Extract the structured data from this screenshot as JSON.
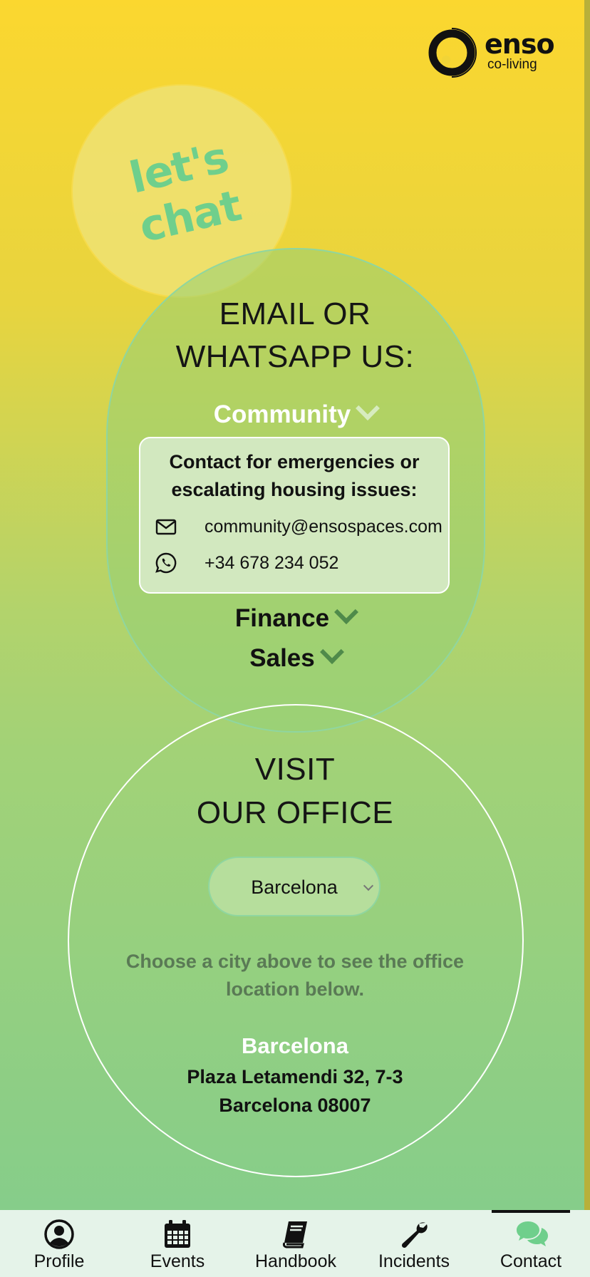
{
  "brand": {
    "name": "enso",
    "tagline": "co-living"
  },
  "hero": {
    "chat_text": "let's chat"
  },
  "email_section": {
    "title_line1": "EMAIL OR",
    "title_line2": "WHATSAPP US:",
    "dropdowns": [
      {
        "label": "Community",
        "expanded": true,
        "description": "Contact for emergencies or escalating housing issues:",
        "email": "community@ensospaces.com",
        "phone": "+34 678 234 052"
      },
      {
        "label": "Finance",
        "expanded": false
      },
      {
        "label": "Sales",
        "expanded": false
      }
    ]
  },
  "office_section": {
    "title_line1": "VISIT",
    "title_line2": "OUR OFFICE",
    "city_select": {
      "selected": "Barcelona"
    },
    "hint": "Choose a city above to see the office location below.",
    "address": {
      "city": "Barcelona",
      "line1": "Plaza Letamendi 32, 7-3",
      "line2": "Barcelona 08007"
    }
  },
  "nav": {
    "active": "Contact",
    "active_color": "#6fcf8c",
    "items": [
      {
        "label": "Profile",
        "icon": "user-circle-icon"
      },
      {
        "label": "Events",
        "icon": "calendar-icon"
      },
      {
        "label": "Handbook",
        "icon": "book-icon"
      },
      {
        "label": "Incidents",
        "icon": "wrench-icon"
      },
      {
        "label": "Contact",
        "icon": "chat-bubbles-icon"
      }
    ]
  }
}
